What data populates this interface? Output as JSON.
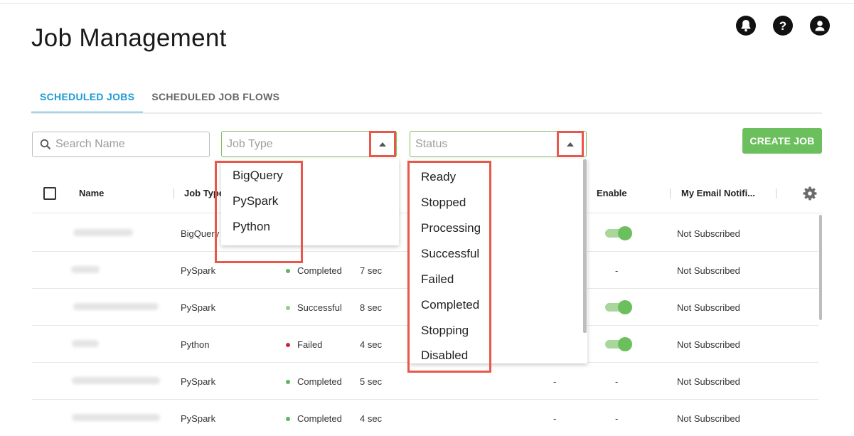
{
  "header": {
    "title": "Job Management",
    "icons": [
      "bell-icon",
      "help-icon",
      "account-icon"
    ]
  },
  "tabs": [
    {
      "label": "SCHEDULED JOBS",
      "active": true
    },
    {
      "label": "SCHEDULED JOB FLOWS",
      "active": false
    }
  ],
  "filters": {
    "search_placeholder": "Search Name",
    "job_type_placeholder": "Job Type",
    "status_placeholder": "Status"
  },
  "create_button": "CREATE JOB",
  "columns": {
    "name": "Name",
    "job_type": "Job Type",
    "enable": "Enable",
    "email": "My Email Notifi..."
  },
  "rows": [
    {
      "type": "BigQuery",
      "status": "",
      "duration": "",
      "enable": true,
      "enable_text": "",
      "email": "Not Subscribed"
    },
    {
      "type": "PySpark",
      "status": "Completed",
      "duration": "7 sec",
      "enable": false,
      "enable_text": "-",
      "email": "Not Subscribed"
    },
    {
      "type": "PySpark",
      "status": "Successful",
      "duration": "8 sec",
      "enable": true,
      "enable_text": "",
      "email": "Not Subscribed"
    },
    {
      "type": "Python",
      "status": "Failed",
      "duration": "4 sec",
      "enable": true,
      "enable_text": "",
      "email": "Not Subscribed"
    },
    {
      "type": "PySpark",
      "status": "Completed",
      "duration": "5 sec",
      "enable": false,
      "enable_text": "-",
      "extra": "-",
      "email": "Not Subscribed"
    },
    {
      "type": "PySpark",
      "status": "Completed",
      "duration": "4 sec",
      "enable": false,
      "enable_text": "-",
      "extra": "-",
      "email": "Not Subscribed"
    }
  ],
  "job_type_options": [
    "BigQuery",
    "PySpark",
    "Python"
  ],
  "status_options": [
    "Ready",
    "Stopped",
    "Processing",
    "Successful",
    "Failed",
    "Completed",
    "Stopping",
    "Disabled"
  ],
  "colors": {
    "accent": "#1a9bd7",
    "primary_button": "#6cbf5d",
    "highlight_box": "#e8574a",
    "status_success": "#5cb85c",
    "status_failed": "#d0243c"
  }
}
